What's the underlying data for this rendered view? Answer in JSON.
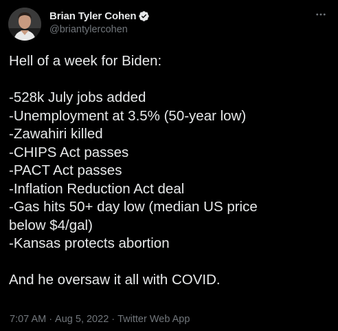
{
  "author": {
    "display_name": "Brian Tyler Cohen",
    "handle": "@briantylercohen",
    "verified": true
  },
  "tweet": {
    "lines": [
      "Hell of a week for Biden:",
      "",
      "-528k July jobs added",
      "-Unemployment at 3.5% (50-year low)",
      "-Zawahiri killed",
      "-CHIPS Act passes",
      "-PACT Act passes",
      "-Inflation Reduction Act deal",
      "-Gas hits 50+ day low (median US price",
      "below $4/gal)",
      "-Kansas protects abortion",
      "",
      "And he oversaw it all with COVID."
    ]
  },
  "meta": {
    "time": "7:07 AM",
    "date": "Aug 5, 2022",
    "source": "Twitter Web App",
    "separator": "·"
  },
  "icons": {
    "verified": "verified-badge-icon",
    "more": "more-horizontal-icon"
  },
  "colors": {
    "background": "#000000",
    "primary_text": "#e7e9ea",
    "secondary_text": "#71767b",
    "verified_badge": "#1d9bf0"
  }
}
